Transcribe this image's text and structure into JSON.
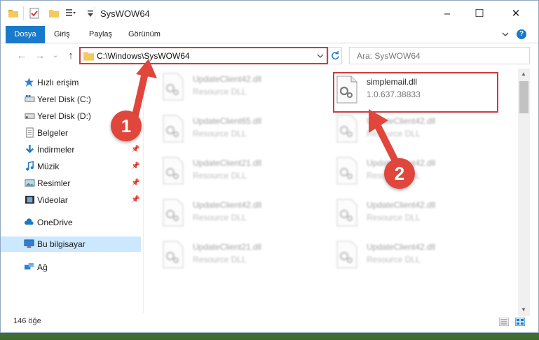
{
  "window": {
    "title": "SysWOW64",
    "minimize_label": "–",
    "maximize_label": "☐",
    "close_label": "✕"
  },
  "ribbon": {
    "tabs": [
      {
        "label": "Dosya",
        "active": true
      },
      {
        "label": "Giriş"
      },
      {
        "label": "Paylaş"
      },
      {
        "label": "Görünüm"
      }
    ],
    "help": "?"
  },
  "address": {
    "path": "C:\\Windows\\SysWOW64",
    "search_placeholder": "Ara: SysWOW64"
  },
  "nav": {
    "items": [
      {
        "label": "Hızlı erişim",
        "icon": "star-icon"
      },
      {
        "label": "Yerel Disk (C:)",
        "icon": "drive-icon"
      },
      {
        "label": "Yerel Disk (D:)",
        "icon": "drive-icon"
      },
      {
        "label": "Belgeler",
        "icon": "document-icon"
      },
      {
        "label": "İndirmeler",
        "icon": "download-icon",
        "pinned": true
      },
      {
        "label": "Müzik",
        "icon": "music-icon",
        "pinned": true
      },
      {
        "label": "Resimler",
        "icon": "pictures-icon",
        "pinned": true
      },
      {
        "label": "Videolar",
        "icon": "video-icon",
        "pinned": true
      },
      {
        "label": "OneDrive",
        "icon": "cloud-icon"
      },
      {
        "label": "Bu bilgisayar",
        "icon": "computer-icon",
        "selected": true
      },
      {
        "label": "Ağ",
        "icon": "network-icon"
      }
    ]
  },
  "files": {
    "left": [
      {
        "name": "UpdateClient42.dll",
        "type": "Resource DLL"
      },
      {
        "name": "UpdateClient65.dll",
        "type": "Resource DLL"
      },
      {
        "name": "UpdateClient21.dll",
        "type": "Resource DLL"
      },
      {
        "name": "UpdateClient42.dll",
        "type": "Resource DLL"
      },
      {
        "name": "UpdateClient21.dll",
        "type": "Resource DLL"
      }
    ],
    "right": [
      {
        "name": "simplemail.dll",
        "type": "1.0.637.38833",
        "highlighted": true
      },
      {
        "name": "UpdateClient42.dll",
        "type": "Resource DLL"
      },
      {
        "name": "UpdateClient42.dll",
        "type": "Resource DLL"
      },
      {
        "name": "UpdateClient42.dll",
        "type": "Resource DLL"
      },
      {
        "name": "UpdateClient42.dll",
        "type": "Resource DLL"
      }
    ]
  },
  "status": {
    "count": "146 öğe"
  },
  "annotations": {
    "step1": "1",
    "step2": "2"
  },
  "colors": {
    "accent": "#1979ca",
    "highlight": "#d0393d",
    "selection": "#cce8ff"
  }
}
